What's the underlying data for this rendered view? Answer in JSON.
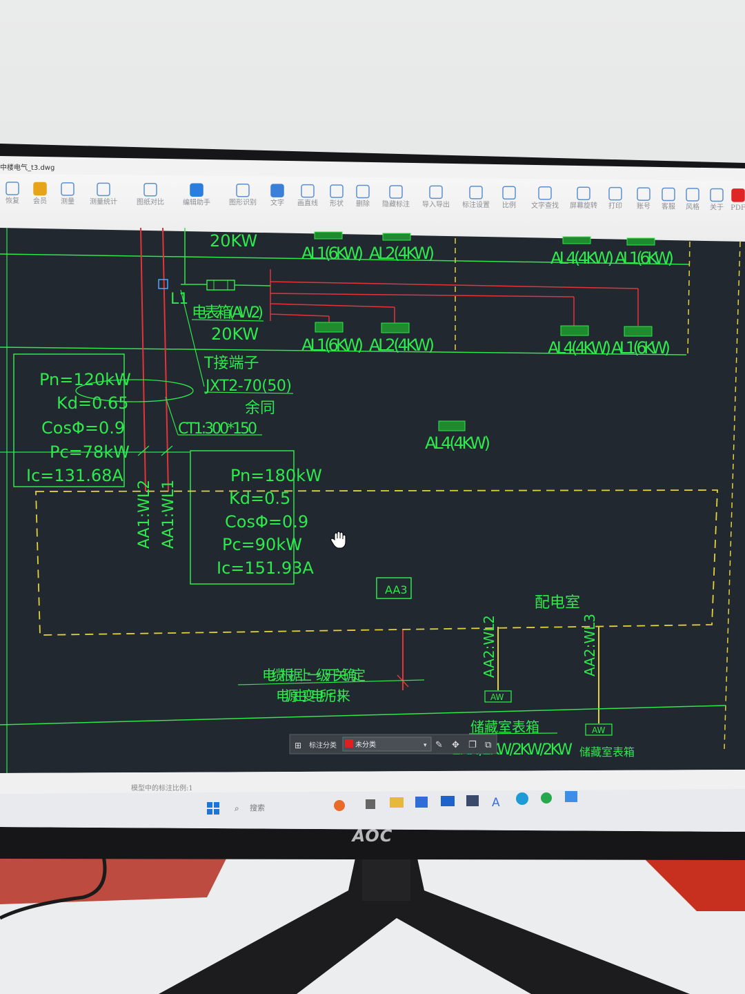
{
  "window": {
    "file_title": "中楼电气_t3.dwg"
  },
  "toolbar": {
    "items": [
      {
        "label": "恢复",
        "icon": "undo-icon"
      },
      {
        "label": "会员",
        "icon": "vip-icon"
      },
      {
        "label": "测量",
        "icon": "measure-icon"
      },
      {
        "label": "测量统计",
        "icon": "measure-stats-icon"
      },
      {
        "label": "图纸对比",
        "icon": "compare-icon"
      },
      {
        "label": "编辑助手",
        "icon": "edit-assistant-icon"
      },
      {
        "label": "图形识别",
        "icon": "recognize-icon"
      },
      {
        "label": "文字",
        "icon": "text-icon"
      },
      {
        "label": "画直线",
        "icon": "line-icon"
      },
      {
        "label": "形状",
        "icon": "shape-icon"
      },
      {
        "label": "删除",
        "icon": "eraser-icon"
      },
      {
        "label": "隐藏标注",
        "icon": "hide-icon"
      },
      {
        "label": "导入导出",
        "icon": "import-export-icon"
      },
      {
        "label": "标注设置",
        "icon": "annotation-settings-icon"
      },
      {
        "label": "比例",
        "icon": "scale-icon"
      },
      {
        "label": "文字查找",
        "icon": "text-search-icon"
      },
      {
        "label": "屏幕旋转",
        "icon": "rotate-icon"
      },
      {
        "label": "打印",
        "icon": "print-icon"
      },
      {
        "label": "账号",
        "icon": "account-icon"
      },
      {
        "label": "客服",
        "icon": "support-icon"
      },
      {
        "label": "风格",
        "icon": "style-icon"
      },
      {
        "label": "关于",
        "icon": "info-icon"
      },
      {
        "label": "PDF",
        "icon": "pdf-icon"
      }
    ]
  },
  "drawing": {
    "top_power": "20KW",
    "top_labels": [
      "AL1(6KW)",
      "AL2(4KW)",
      "AL4(4KW)",
      "AL1(6KW)"
    ],
    "l1_label": "L1",
    "meter_box": "电表箱(AW2)",
    "mid_power": "20KW",
    "mid_labels": [
      "AL1(6KW)",
      "AL2(4KW)",
      "AL4(4KW)",
      "AL1(6KW)"
    ],
    "t_terminal": "T接端子",
    "jxt": "JXT2-70(50)",
    "same": "余同",
    "ct": "CT1:300*150",
    "box1": [
      "Pn=120kW",
      "Kd=0.65",
      "CosΦ=0.9",
      "Pc=78kW",
      "Ic=131.68A"
    ],
    "box2": [
      "Pn=180kW",
      "Kd=0.5",
      "CosΦ=0.9",
      "Pc=90kW",
      "Ic=151.93A"
    ],
    "al4_single": "AL4(4KW)",
    "wl2": "AA1:WL2",
    "wl1": "AA1:WL1",
    "aa3": "AA3",
    "room": "配电室",
    "aa2_wl2": "AA2:WL2",
    "aa2_wl3": "AA2:WL3",
    "aw": "AW",
    "cable_note": "电缆根据上一级开关确定",
    "source_note": "电源由变电所引来",
    "storage_box": "储藏室表箱",
    "kw_row": "2KW/2KW/2KW/2KW",
    "storage_box2": "储藏室表箱"
  },
  "annotation_bar": {
    "label": "标注分类",
    "value": "未分类"
  },
  "status": {
    "text": "模型中的标注比例:1"
  },
  "taskbar": {
    "search_placeholder": "搜索"
  },
  "monitor": {
    "brand": "AOC"
  }
}
